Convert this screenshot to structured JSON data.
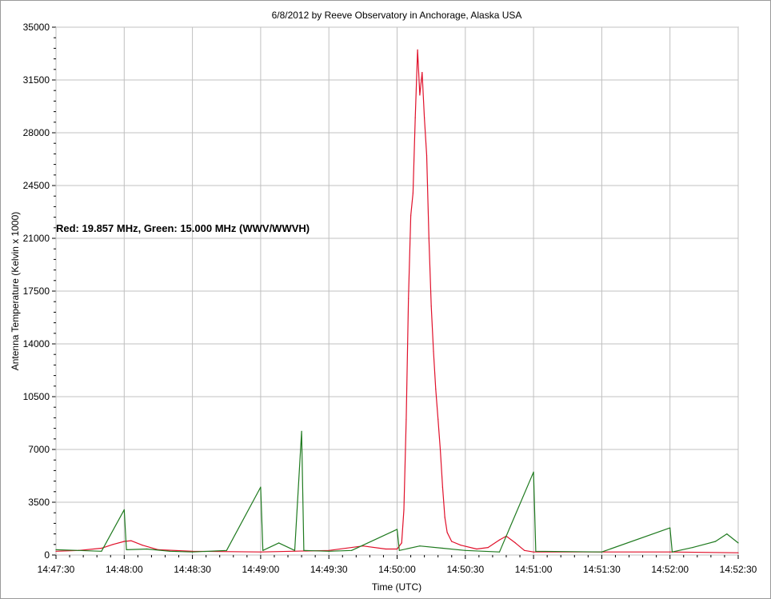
{
  "chart_data": {
    "type": "line",
    "title": "6/8/2012  by  Reeve Observatory  in  Anchorage, Alaska  USA",
    "xlabel": "Time (UTC)",
    "ylabel": "Antenna Temperature (Kelvin x 1000)",
    "annotation": "Red: 19.857 MHz, Green: 15.000 MHz (WWV/WWVH)",
    "xlim": [
      "14:47:30",
      "14:52:30"
    ],
    "ylim": [
      0,
      35000
    ],
    "x_ticks": [
      "14:47:30",
      "14:48:00",
      "14:48:30",
      "14:49:00",
      "14:49:30",
      "14:50:00",
      "14:50:30",
      "14:51:00",
      "14:51:30",
      "14:52:00",
      "14:52:30"
    ],
    "y_ticks": [
      0,
      3500,
      7000,
      10500,
      14000,
      17500,
      21000,
      24500,
      28000,
      31500,
      35000
    ],
    "grid": true,
    "series": [
      {
        "name": "Red: 19.857 MHz",
        "color": "#e0102a",
        "points": [
          [
            "14:47:30",
            250
          ],
          [
            "14:47:40",
            300
          ],
          [
            "14:47:50",
            450
          ],
          [
            "14:47:55",
            700
          ],
          [
            "14:48:00",
            900
          ],
          [
            "14:48:03",
            950
          ],
          [
            "14:48:08",
            650
          ],
          [
            "14:48:15",
            350
          ],
          [
            "14:48:30",
            250
          ],
          [
            "14:49:00",
            200
          ],
          [
            "14:49:30",
            300
          ],
          [
            "14:49:45",
            600
          ],
          [
            "14:49:55",
            400
          ],
          [
            "14:50:00",
            400
          ],
          [
            "14:50:02",
            800
          ],
          [
            "14:50:03",
            3000
          ],
          [
            "14:50:04",
            9000
          ],
          [
            "14:50:05",
            17000
          ],
          [
            "14:50:06",
            22500
          ],
          [
            "14:50:07",
            24000
          ],
          [
            "14:50:08",
            29000
          ],
          [
            "14:50:09",
            33500
          ],
          [
            "14:50:10",
            30500
          ],
          [
            "14:50:11",
            32000
          ],
          [
            "14:50:12",
            29000
          ],
          [
            "14:50:13",
            26500
          ],
          [
            "14:50:14",
            21000
          ],
          [
            "14:50:15",
            16500
          ],
          [
            "14:50:16",
            13500
          ],
          [
            "14:50:17",
            11000
          ],
          [
            "14:50:18",
            9000
          ],
          [
            "14:50:19",
            7000
          ],
          [
            "14:50:20",
            4500
          ],
          [
            "14:50:21",
            2500
          ],
          [
            "14:50:22",
            1500
          ],
          [
            "14:50:24",
            900
          ],
          [
            "14:50:28",
            650
          ],
          [
            "14:50:35",
            400
          ],
          [
            "14:50:40",
            500
          ],
          [
            "14:50:45",
            1000
          ],
          [
            "14:50:48",
            1250
          ],
          [
            "14:50:52",
            800
          ],
          [
            "14:50:56",
            300
          ],
          [
            "14:51:00",
            200
          ],
          [
            "14:51:30",
            200
          ],
          [
            "14:52:00",
            200
          ],
          [
            "14:52:30",
            150
          ]
        ]
      },
      {
        "name": "Green: 15.000 MHz (WWV/WWVH)",
        "color": "#1f7a1f",
        "points": [
          [
            "14:47:30",
            350
          ],
          [
            "14:47:40",
            300
          ],
          [
            "14:47:50",
            250
          ],
          [
            "14:48:00",
            3000
          ],
          [
            "14:48:01",
            350
          ],
          [
            "14:48:10",
            400
          ],
          [
            "14:48:20",
            250
          ],
          [
            "14:48:30",
            200
          ],
          [
            "14:48:45",
            300
          ],
          [
            "14:49:00",
            4500
          ],
          [
            "14:49:01",
            300
          ],
          [
            "14:49:08",
            800
          ],
          [
            "14:49:15",
            300
          ],
          [
            "14:49:18",
            8200
          ],
          [
            "14:49:19",
            300
          ],
          [
            "14:49:30",
            250
          ],
          [
            "14:49:40",
            300
          ],
          [
            "14:50:00",
            1700
          ],
          [
            "14:50:01",
            300
          ],
          [
            "14:50:10",
            600
          ],
          [
            "14:50:20",
            450
          ],
          [
            "14:50:30",
            300
          ],
          [
            "14:50:45",
            200
          ],
          [
            "14:51:00",
            5500
          ],
          [
            "14:51:01",
            250
          ],
          [
            "14:51:30",
            200
          ],
          [
            "14:52:00",
            1800
          ],
          [
            "14:52:01",
            200
          ],
          [
            "14:52:10",
            500
          ],
          [
            "14:52:20",
            900
          ],
          [
            "14:52:25",
            1400
          ],
          [
            "14:52:30",
            800
          ]
        ]
      }
    ]
  }
}
